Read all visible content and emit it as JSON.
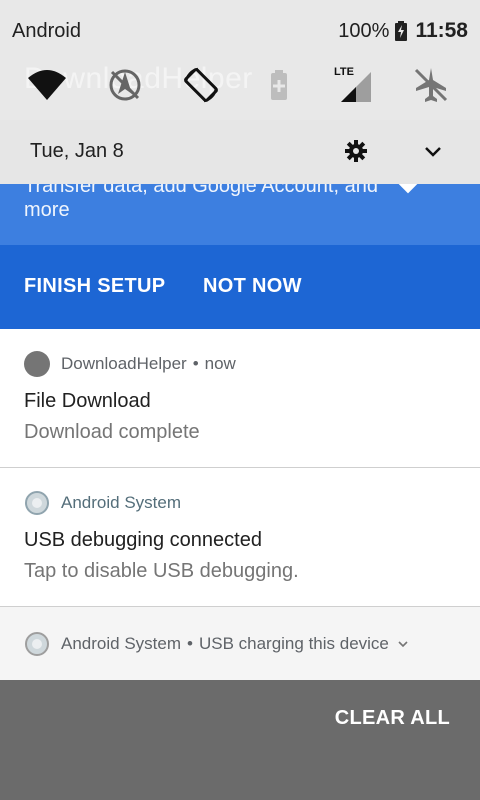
{
  "status_bar": {
    "carrier": "Android",
    "battery_percent": "100%",
    "time": "11:58"
  },
  "quick_settings": {
    "background_title": "DownloadHelper",
    "icons": [
      "wifi-icon",
      "location-off-icon",
      "auto-rotate-icon",
      "battery-saver-icon",
      "lte-signal-icon",
      "airplane-mode-icon"
    ],
    "lte_label": "LTE"
  },
  "header": {
    "date": "Tue, Jan 8",
    "settings_icon": "gear-icon",
    "expand_icon": "chevron-down-icon"
  },
  "setup_card": {
    "text": "Transfer data, add Google Account, and more",
    "finish_label": "FINISH SETUP",
    "not_now_label": "NOT NOW",
    "color": "#1d66d4"
  },
  "notifications": [
    {
      "app": "DownloadHelper",
      "time": "now",
      "title": "File Download",
      "body": "Download complete"
    },
    {
      "app": "Android System",
      "title": "USB debugging connected",
      "body": "Tap to disable USB debugging."
    },
    {
      "app": "Android System",
      "summary": "USB charging this device"
    }
  ],
  "footer": {
    "clear_all_label": "CLEAR ALL"
  }
}
